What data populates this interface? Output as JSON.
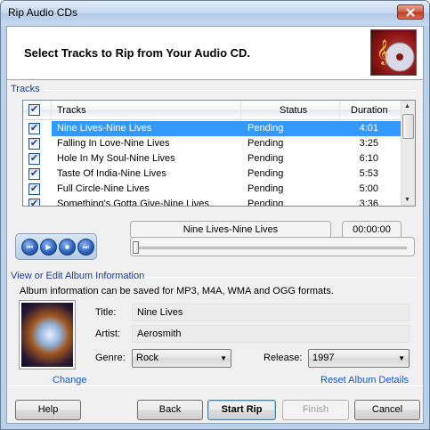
{
  "window": {
    "title": "Rip Audio CDs"
  },
  "header": {
    "title": "Select Tracks to Rip from Your Audio CD."
  },
  "tracks_group": {
    "label": "Tracks"
  },
  "track_list": {
    "columns": {
      "tracks": "Tracks",
      "status": "Status",
      "duration": "Duration"
    },
    "rows": [
      {
        "title": "Nine Lives-Nine Lives",
        "status": "Pending",
        "duration": "4:01",
        "checked": true,
        "selected": true
      },
      {
        "title": "Falling In Love-Nine Lives",
        "status": "Pending",
        "duration": "3:25",
        "checked": true,
        "selected": false
      },
      {
        "title": "Hole In My Soul-Nine Lives",
        "status": "Pending",
        "duration": "6:10",
        "checked": true,
        "selected": false
      },
      {
        "title": "Taste Of India-Nine Lives",
        "status": "Pending",
        "duration": "5:53",
        "checked": true,
        "selected": false
      },
      {
        "title": "Full Circle-Nine Lives",
        "status": "Pending",
        "duration": "5:00",
        "checked": true,
        "selected": false
      },
      {
        "title": "Something's Gotta Give-Nine Lives",
        "status": "Pending",
        "duration": "3:36",
        "checked": true,
        "selected": false
      }
    ]
  },
  "player": {
    "now_playing": "Nine Lives-Nine Lives",
    "time": "00:00:00",
    "seek_position": 0
  },
  "album_group": {
    "label": "View or Edit Album Information",
    "note": "Album information can be saved for MP3, M4A, WMA and OGG formats.",
    "title_label": "Title:",
    "title_value": "Nine Lives",
    "artist_label": "Artist:",
    "artist_value": "Aerosmith",
    "genre_label": "Genre:",
    "genre_value": "Rock",
    "release_label": "Release:",
    "release_value": "1997",
    "change_link": "Change",
    "reset_link": "Reset Album Details"
  },
  "buttons": {
    "help": "Help",
    "back": "Back",
    "start_rip": "Start Rip",
    "finish": "Finish",
    "cancel": "Cancel"
  },
  "colors": {
    "selection": "#3399ff",
    "group_label": "#1e3a96",
    "link": "#1a55c8"
  }
}
